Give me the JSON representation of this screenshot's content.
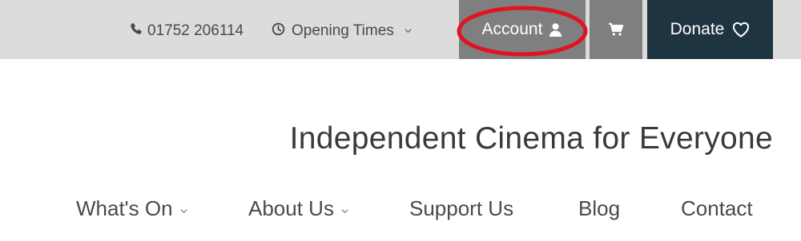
{
  "topbar": {
    "phone": "01752 206114",
    "opening_times": "Opening Times",
    "account_label": "Account",
    "donate_label": "Donate",
    "colors": {
      "bar_bg": "#dcdcdc",
      "account_bg": "#7f7f7f",
      "cart_bg": "#7f7f7f",
      "donate_bg": "#1f3441",
      "annotation": "#e0141e"
    }
  },
  "tagline": "Independent Cinema for Everyone",
  "nav": {
    "items": [
      {
        "label": "What's On",
        "has_dropdown": true
      },
      {
        "label": "About Us",
        "has_dropdown": true
      },
      {
        "label": "Support Us",
        "has_dropdown": false
      },
      {
        "label": "Blog",
        "has_dropdown": false
      },
      {
        "label": "Contact",
        "has_dropdown": false
      }
    ]
  },
  "icons": [
    "phone-icon",
    "clock-icon",
    "chevron-down-icon",
    "user-icon",
    "cart-icon",
    "heart-icon"
  ]
}
